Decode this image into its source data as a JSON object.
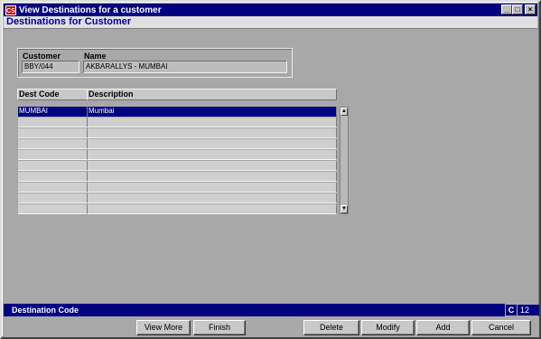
{
  "window": {
    "title": "View Destinations for a customer",
    "icon_text": "CS"
  },
  "form": {
    "title": "Destinations for Customer"
  },
  "customer": {
    "code_label": "Customer",
    "code_value": "BBY/044",
    "name_label": "Name",
    "name_value": "AKBARALLYS - MUMBAI"
  },
  "grid": {
    "columns": [
      "Dest Code",
      "Description"
    ],
    "rows": [
      {
        "code": "MUMBAI",
        "description": "Mumbai"
      }
    ]
  },
  "status": {
    "field": "Destination Code",
    "mode": "C",
    "count": "12"
  },
  "buttons": {
    "view_more": "View More",
    "finish": "Finish",
    "delete": "Delete",
    "modify": "Modify",
    "add": "Add",
    "cancel": "Cancel"
  },
  "colors": {
    "titlebar": "#000080",
    "selection": "#000080",
    "form_title": "#0000a0",
    "background": "#a8a8a8"
  }
}
